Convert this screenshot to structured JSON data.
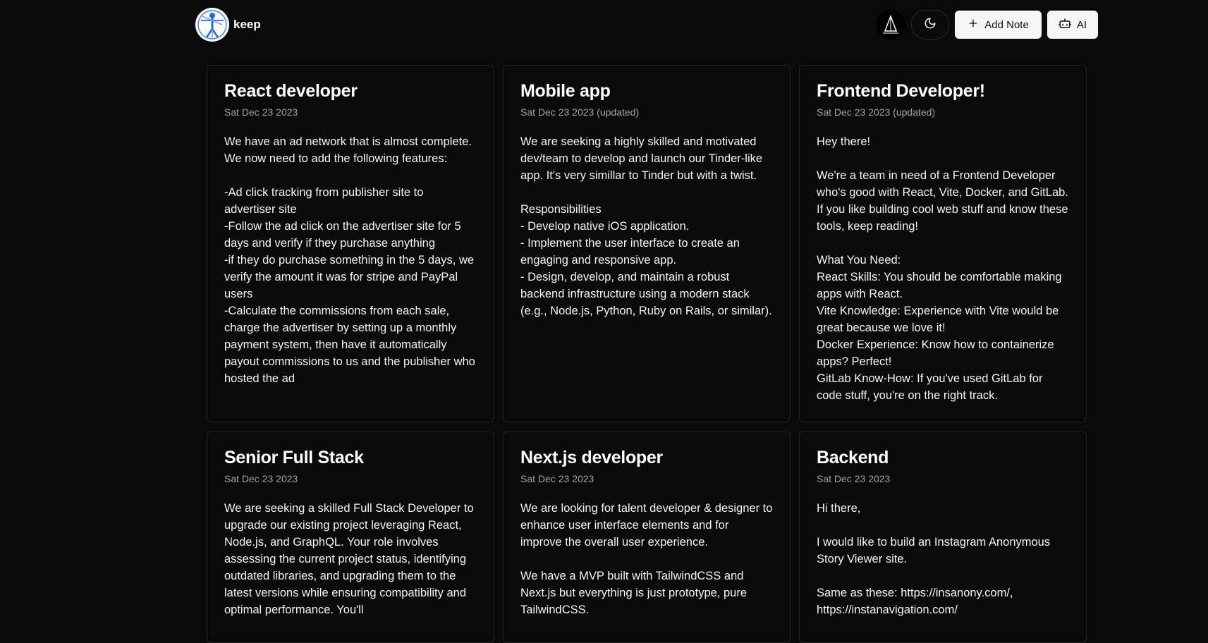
{
  "header": {
    "brand": "keep",
    "add_note_label": "Add Note",
    "ai_label": "AI",
    "icons": {
      "logo": "vitruvian-man-logo",
      "avatar": "user-avatar",
      "theme": "moon-icon",
      "add": "plus-icon",
      "ai": "bot-icon"
    }
  },
  "notes": [
    {
      "title": "React developer",
      "date": "Sat Dec 23 2023",
      "body": "We have an ad network that is almost complete. We now need to add the following features:\n\n-Ad click tracking from publisher site to advertiser site\n-Follow the ad click on the advertiser site for 5 days and verify if they purchase anything\n-if they do purchase something in the 5 days, we verify the amount it was for stripe and PayPal users\n-Calculate the commissions from each sale, charge the advertiser by setting up a monthly payment system, then have it automatically payout commissions to us and the publisher who hosted the ad"
    },
    {
      "title": "Mobile app",
      "date": "Sat Dec 23 2023 (updated)",
      "body": "We are seeking a highly skilled and motivated dev/team to develop and launch our Tinder-like app. It's very simillar to Tinder but with a twist.\n\nResponsibilities\n- Develop native iOS application.\n- Implement the user interface to create an engaging and responsive app.\n- Design, develop, and maintain a robust backend infrastructure using a modern stack (e.g., Node.js, Python, Ruby on Rails, or similar)."
    },
    {
      "title": "Frontend Developer!",
      "date": "Sat Dec 23 2023 (updated)",
      "body": "Hey there!\n\nWe're a team in need of a Frontend Developer who's good with React, Vite, Docker, and GitLab. If you like building cool web stuff and know these tools, keep reading!\n\nWhat You Need:\nReact Skills: You should be comfortable making apps with React.\nVite Knowledge: Experience with Vite would be great because we love it!\nDocker Experience: Know how to containerize apps? Perfect!\nGitLab Know-How: If you've used GitLab for code stuff, you're on the right track."
    },
    {
      "title": "Senior Full Stack",
      "date": "Sat Dec 23 2023",
      "body": "We are seeking a skilled Full Stack Developer to upgrade our existing project leveraging React, Node.js, and GraphQL. Your role involves assessing the current project status, identifying outdated libraries, and upgrading them to the latest versions while ensuring compatibility and optimal performance. You'll"
    },
    {
      "title": "Next.js developer",
      "date": "Sat Dec 23 2023",
      "body": "We are looking for talent developer & designer to enhance user interface elements and for improve the overall user experience.\n\nWe have a MVP built with TailwindCSS and Next.js but everything is just prototype, pure TailwindCSS."
    },
    {
      "title": "Backend",
      "date": "Sat Dec 23 2023",
      "body": "Hi there,\n\nI would like to build an Instagram Anonymous Story Viewer site.\n\nSame as these: https://insanony.com/,\nhttps://instanavigation.com/"
    }
  ]
}
